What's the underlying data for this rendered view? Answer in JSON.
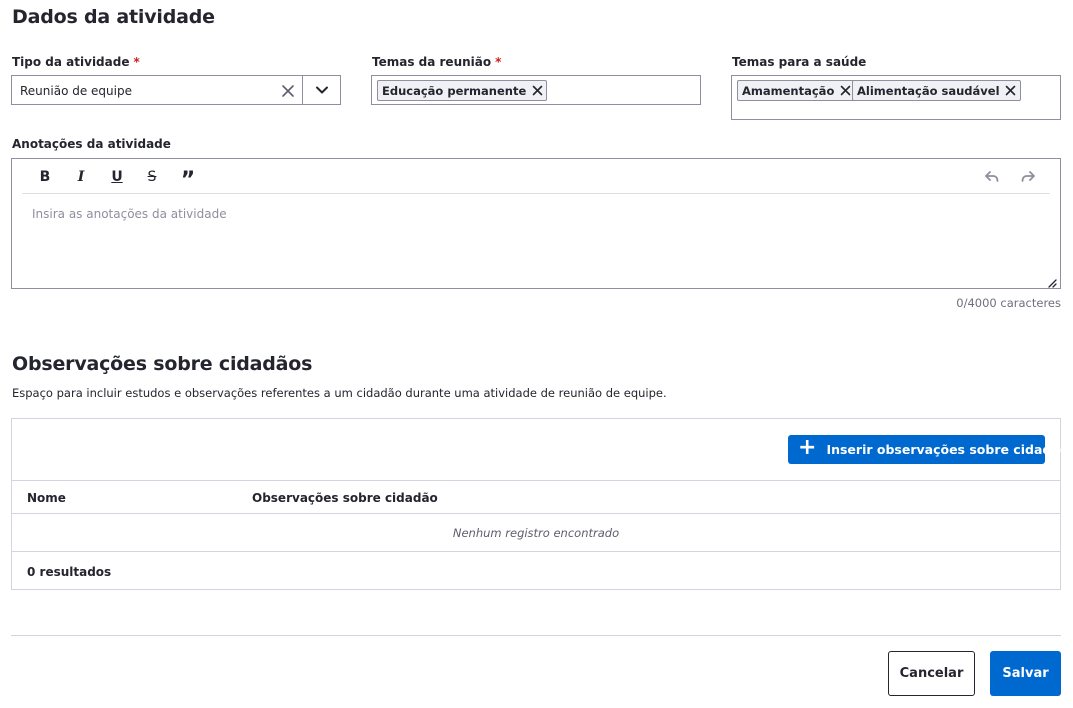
{
  "activity": {
    "title": "Dados da atividade",
    "type_label": "Tipo da atividade",
    "type_required": "*",
    "type_value": "Reunião de equipe",
    "meeting_themes_label": "Temas da reunião",
    "meeting_themes_required": "*",
    "meeting_themes": [
      "Educação permanente"
    ],
    "health_themes_label": "Temas para a saúde",
    "health_themes": [
      "Amamentação",
      "Alimentação saudável"
    ],
    "notes_label": "Anotações da atividade",
    "notes_placeholder": "Insira as anotações da atividade",
    "notes_counter": "0/4000 caracteres",
    "toolbar": {
      "bold_icon": "B",
      "italic_icon": "I",
      "underline_icon": "U",
      "strike_icon": "S",
      "quote_icon": "”"
    }
  },
  "observations": {
    "title": "Observações sobre cidadãos",
    "description": "Espaço para incluir estudos e observações referentes a um cidadão durante uma atividade de reunião de equipe.",
    "insert_button_icon": "+",
    "insert_button_label": "Inserir observações sobre cidadão",
    "columns": [
      "Nome",
      "Observações sobre cidadão"
    ],
    "empty_text": "Nenhum registro encontrado",
    "results": "0 resultados"
  },
  "footer": {
    "cancel_label": "Cancelar",
    "save_label": "Salvar"
  },
  "colors": {
    "primary": "#0069d0",
    "required": "#d01e1e",
    "border": "#8f8fa2"
  }
}
